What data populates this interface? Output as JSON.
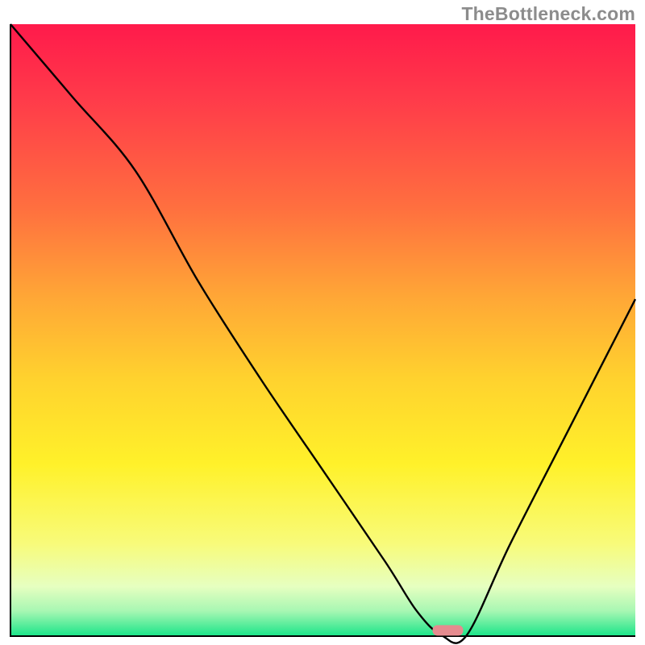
{
  "watermark": "TheBottleneck.com",
  "chart_data": {
    "type": "line",
    "title": "",
    "xlabel": "",
    "ylabel": "",
    "xlim": [
      0,
      100
    ],
    "ylim": [
      0,
      100
    ],
    "series": [
      {
        "name": "bottleneck-curve",
        "x": [
          0,
          10,
          20,
          30,
          40,
          50,
          60,
          65,
          69,
          73,
          80,
          90,
          100
        ],
        "values": [
          100,
          88,
          76,
          58,
          42,
          27,
          12,
          4,
          0,
          0,
          15,
          35,
          55
        ]
      }
    ],
    "marker": {
      "name": "optimal-point",
      "x": 70,
      "y": 0.8,
      "shape": "pill",
      "color": "#e58b8f"
    },
    "background_gradient": {
      "stops": [
        {
          "pos": 0,
          "color": "#ff1a4b"
        },
        {
          "pos": 12,
          "color": "#ff3a4a"
        },
        {
          "pos": 30,
          "color": "#ff6f3f"
        },
        {
          "pos": 45,
          "color": "#ffa836"
        },
        {
          "pos": 58,
          "color": "#ffd22e"
        },
        {
          "pos": 72,
          "color": "#fff12a"
        },
        {
          "pos": 85,
          "color": "#f8fb7a"
        },
        {
          "pos": 92,
          "color": "#e6ffc0"
        },
        {
          "pos": 96,
          "color": "#a8f7b3"
        },
        {
          "pos": 100,
          "color": "#1ee58a"
        }
      ]
    }
  }
}
